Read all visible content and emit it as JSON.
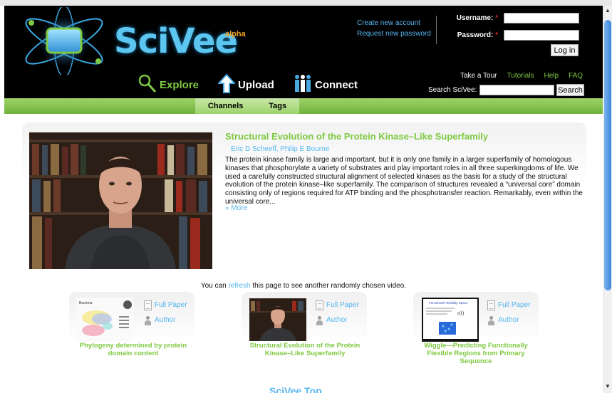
{
  "header": {
    "logo": {
      "name": "SciVee",
      "tag": "alpha"
    },
    "account_links": {
      "create": "Create new account",
      "request": "Request new password"
    },
    "login": {
      "username_label": "Username:",
      "password_label": "Password:",
      "required_mark": "*",
      "button": "Log in"
    },
    "nav": {
      "explore": "Explore",
      "upload": "Upload",
      "connect": "Connect"
    },
    "top_links": {
      "tour": "Take a Tour",
      "tutorials": "Tutorials",
      "help": "Help",
      "faq": "FAQ"
    },
    "search": {
      "label": "Search SciVee:",
      "button": "Search"
    }
  },
  "subnav": {
    "channels": "Channels",
    "tags": "Tags"
  },
  "featured": {
    "title": "Structural Evolution of the Protein Kinase–Like Superfamily",
    "authors": "Eric D Scheeff, Philip E Bourne",
    "abstract": "The protein kinase family is large and important, but it is only one family in a larger superfamily of homologous kinases that phosphorylate a variety of substrates and play important roles in all three superkingdoms of life. We used a carefully constructed structural alignment of selected kinases as the basis for a study of the structural evolution of the protein kinase–like superfamily. The comparison of structures revealed a “universal core” domain consisting only of regions required for ATP binding and the phosphotransfer reaction. Remarkably, even within the universal core...",
    "more": "» More"
  },
  "refresh": {
    "before": "You can ",
    "link": "refresh",
    "after": " this page to see another randomly chosen video."
  },
  "cards": [
    {
      "title": "Phylogeny determined by protein domain content",
      "full_paper": "Full Paper",
      "author": "Author"
    },
    {
      "title": "Structural Evolution of the Protein Kinase–Like Superfamily",
      "full_paper": "Full Paper",
      "author": "Author"
    },
    {
      "title": "Wiggle—Predicting Functionally Flexible Regions from Primary Sequence",
      "full_paper": "Full Paper",
      "author": "Author"
    }
  ],
  "bottom_heading": "SciVee Top",
  "colors": {
    "green": "#7ec942",
    "blue_link": "#56b6f0",
    "header_bg": "#000000",
    "subnav": "#8cc657"
  },
  "icons": [
    "magnifier-icon",
    "upload-arrow-icon",
    "people-icon",
    "document-icon",
    "person-icon"
  ]
}
